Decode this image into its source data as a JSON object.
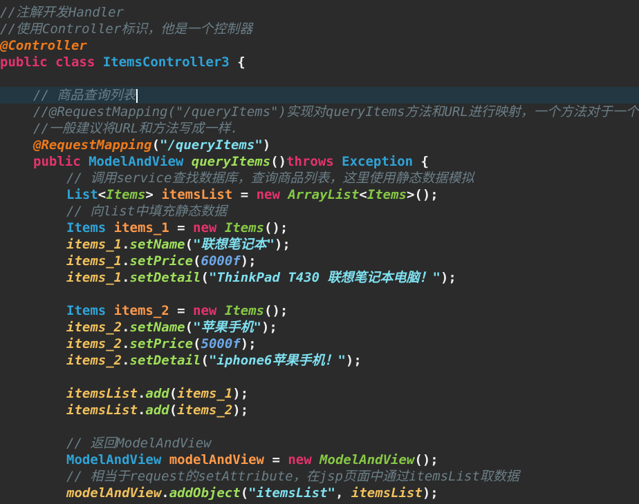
{
  "editor": {
    "lines": [
      {
        "indent": 0,
        "tokens": [
          {
            "t": "//注解开发Handler",
            "c": "comment"
          }
        ]
      },
      {
        "indent": 0,
        "tokens": [
          {
            "t": "//使用Controller标识，他是一个控制器",
            "c": "comment"
          }
        ]
      },
      {
        "indent": 0,
        "tokens": [
          {
            "t": "@Controller",
            "c": "ann"
          }
        ]
      },
      {
        "indent": 0,
        "tokens": [
          {
            "t": "public class ",
            "c": "kw"
          },
          {
            "t": "ItemsController3",
            "c": "type"
          },
          {
            "t": " {",
            "c": "plain"
          }
        ]
      },
      {
        "indent": 0,
        "tokens": []
      },
      {
        "indent": 1,
        "current": true,
        "caret": true,
        "tokens": [
          {
            "t": "// 商品查询列表",
            "c": "comment"
          }
        ]
      },
      {
        "indent": 1,
        "tokens": [
          {
            "t": "//@RequestMapping(\"/queryItems\")实现对queryItems方法和URL进行映射，一个方法对于一个U",
            "c": "comment"
          }
        ]
      },
      {
        "indent": 1,
        "tokens": [
          {
            "t": "//一般建议将URL和方法写成一样.",
            "c": "comment"
          }
        ]
      },
      {
        "indent": 1,
        "tokens": [
          {
            "t": "@RequestMapping",
            "c": "ann"
          },
          {
            "t": "(",
            "c": "plain"
          },
          {
            "t": "\"/queryItems\"",
            "c": "str"
          },
          {
            "t": ")",
            "c": "plain"
          }
        ]
      },
      {
        "indent": 1,
        "tokens": [
          {
            "t": "public ",
            "c": "kw"
          },
          {
            "t": "ModelAndView ",
            "c": "type"
          },
          {
            "t": "queryItems",
            "c": "fn"
          },
          {
            "t": "()",
            "c": "plain"
          },
          {
            "t": "throws ",
            "c": "kw"
          },
          {
            "t": "Exception",
            "c": "type"
          },
          {
            "t": " {",
            "c": "plain"
          }
        ]
      },
      {
        "indent": 2,
        "tokens": [
          {
            "t": "// 调用service查找数据库，查询商品列表，这里使用静态数据模拟",
            "c": "comment"
          }
        ]
      },
      {
        "indent": 2,
        "tokens": [
          {
            "t": "List",
            "c": "type"
          },
          {
            "t": "<",
            "c": "plain"
          },
          {
            "t": "Items",
            "c": "class"
          },
          {
            "t": "> ",
            "c": "plain"
          },
          {
            "t": "itemsList",
            "c": "param"
          },
          {
            "t": " = ",
            "c": "plain"
          },
          {
            "t": "new ",
            "c": "kw"
          },
          {
            "t": "ArrayList",
            "c": "class"
          },
          {
            "t": "<",
            "c": "plain"
          },
          {
            "t": "Items",
            "c": "class"
          },
          {
            "t": ">();",
            "c": "plain"
          }
        ]
      },
      {
        "indent": 2,
        "tokens": [
          {
            "t": "// 向list中填充静态数据",
            "c": "comment"
          }
        ]
      },
      {
        "indent": 2,
        "tokens": [
          {
            "t": "Items ",
            "c": "type"
          },
          {
            "t": "items_1",
            "c": "param"
          },
          {
            "t": " = ",
            "c": "plain"
          },
          {
            "t": "new ",
            "c": "kw"
          },
          {
            "t": "Items",
            "c": "class"
          },
          {
            "t": "();",
            "c": "plain"
          }
        ]
      },
      {
        "indent": 2,
        "tokens": [
          {
            "t": "items_1",
            "c": "var"
          },
          {
            "t": ".",
            "c": "plain"
          },
          {
            "t": "setName",
            "c": "fn"
          },
          {
            "t": "(",
            "c": "plain"
          },
          {
            "t": "\"联想笔记本\"",
            "c": "str"
          },
          {
            "t": ");",
            "c": "plain"
          }
        ]
      },
      {
        "indent": 2,
        "tokens": [
          {
            "t": "items_1",
            "c": "var"
          },
          {
            "t": ".",
            "c": "plain"
          },
          {
            "t": "setPrice",
            "c": "fn"
          },
          {
            "t": "(",
            "c": "plain"
          },
          {
            "t": "6000f",
            "c": "num"
          },
          {
            "t": ");",
            "c": "plain"
          }
        ]
      },
      {
        "indent": 2,
        "tokens": [
          {
            "t": "items_1",
            "c": "var"
          },
          {
            "t": ".",
            "c": "plain"
          },
          {
            "t": "setDetail",
            "c": "fn"
          },
          {
            "t": "(",
            "c": "plain"
          },
          {
            "t": "\"ThinkPad T430 联想笔记本电脑！\"",
            "c": "str"
          },
          {
            "t": ");",
            "c": "plain"
          }
        ]
      },
      {
        "indent": 0,
        "tokens": []
      },
      {
        "indent": 2,
        "tokens": [
          {
            "t": "Items ",
            "c": "type"
          },
          {
            "t": "items_2",
            "c": "param"
          },
          {
            "t": " = ",
            "c": "plain"
          },
          {
            "t": "new ",
            "c": "kw"
          },
          {
            "t": "Items",
            "c": "class"
          },
          {
            "t": "();",
            "c": "plain"
          }
        ]
      },
      {
        "indent": 2,
        "tokens": [
          {
            "t": "items_2",
            "c": "var"
          },
          {
            "t": ".",
            "c": "plain"
          },
          {
            "t": "setName",
            "c": "fn"
          },
          {
            "t": "(",
            "c": "plain"
          },
          {
            "t": "\"苹果手机\"",
            "c": "str"
          },
          {
            "t": ");",
            "c": "plain"
          }
        ]
      },
      {
        "indent": 2,
        "tokens": [
          {
            "t": "items_2",
            "c": "var"
          },
          {
            "t": ".",
            "c": "plain"
          },
          {
            "t": "setPrice",
            "c": "fn"
          },
          {
            "t": "(",
            "c": "plain"
          },
          {
            "t": "5000f",
            "c": "num"
          },
          {
            "t": ");",
            "c": "plain"
          }
        ]
      },
      {
        "indent": 2,
        "tokens": [
          {
            "t": "items_2",
            "c": "var"
          },
          {
            "t": ".",
            "c": "plain"
          },
          {
            "t": "setDetail",
            "c": "fn"
          },
          {
            "t": "(",
            "c": "plain"
          },
          {
            "t": "\"iphone6苹果手机！\"",
            "c": "str"
          },
          {
            "t": ");",
            "c": "plain"
          }
        ]
      },
      {
        "indent": 0,
        "tokens": []
      },
      {
        "indent": 2,
        "tokens": [
          {
            "t": "itemsList",
            "c": "var"
          },
          {
            "t": ".",
            "c": "plain"
          },
          {
            "t": "add",
            "c": "fn"
          },
          {
            "t": "(",
            "c": "plain"
          },
          {
            "t": "items_1",
            "c": "var"
          },
          {
            "t": ");",
            "c": "plain"
          }
        ]
      },
      {
        "indent": 2,
        "tokens": [
          {
            "t": "itemsList",
            "c": "var"
          },
          {
            "t": ".",
            "c": "plain"
          },
          {
            "t": "add",
            "c": "fn"
          },
          {
            "t": "(",
            "c": "plain"
          },
          {
            "t": "items_2",
            "c": "var"
          },
          {
            "t": ");",
            "c": "plain"
          }
        ]
      },
      {
        "indent": 0,
        "tokens": []
      },
      {
        "indent": 2,
        "tokens": [
          {
            "t": "// 返回ModelAndView",
            "c": "comment"
          }
        ]
      },
      {
        "indent": 2,
        "tokens": [
          {
            "t": "ModelAndView ",
            "c": "type"
          },
          {
            "t": "modelAndView",
            "c": "param"
          },
          {
            "t": " = ",
            "c": "plain"
          },
          {
            "t": "new ",
            "c": "kw"
          },
          {
            "t": "ModelAndView",
            "c": "class"
          },
          {
            "t": "();",
            "c": "plain"
          }
        ]
      },
      {
        "indent": 2,
        "tokens": [
          {
            "t": "// 相当于request的setAttribute，在jsp页面中通过itemsList取数据",
            "c": "comment"
          }
        ]
      },
      {
        "indent": 2,
        "tokens": [
          {
            "t": "modelAndView",
            "c": "var"
          },
          {
            "t": ".",
            "c": "plain"
          },
          {
            "t": "addObject",
            "c": "fn"
          },
          {
            "t": "(",
            "c": "plain"
          },
          {
            "t": "\"itemsList\"",
            "c": "str"
          },
          {
            "t": ", ",
            "c": "plain"
          },
          {
            "t": "itemsList",
            "c": "var"
          },
          {
            "t": ");",
            "c": "plain"
          }
        ]
      }
    ]
  }
}
